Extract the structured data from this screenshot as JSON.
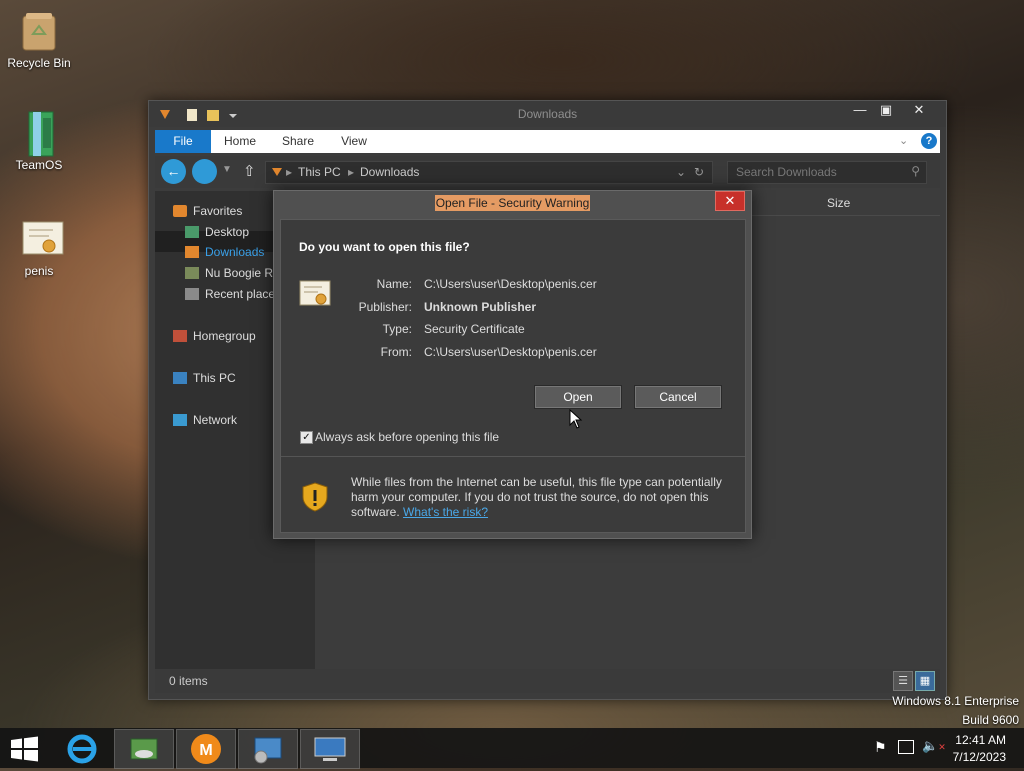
{
  "desktop": {
    "icons": [
      {
        "label": "Recycle Bin",
        "icon": "recycle-bin-icon"
      },
      {
        "label": "TeamOS",
        "icon": "folder-icon"
      },
      {
        "label": "penis",
        "icon": "certificate-file-icon"
      }
    ],
    "watermark": {
      "edition": "Windows 8.1 Enterprise",
      "build": "Build 9600"
    }
  },
  "explorer": {
    "title": "Downloads",
    "tabs": {
      "file": "File",
      "home": "Home",
      "share": "Share",
      "view": "View"
    },
    "address": {
      "root": "This PC",
      "current": "Downloads"
    },
    "search_placeholder": "Search Downloads",
    "nav": {
      "favorites": "Favorites",
      "desktop": "Desktop",
      "downloads": "Downloads",
      "nu_boogie": "Nu Boogie R",
      "recent": "Recent place",
      "homegroup": "Homegroup",
      "this_pc": "This PC",
      "network": "Network"
    },
    "column_size": "Size",
    "status": "0 items"
  },
  "dialog": {
    "title": "Open File - Security Warning",
    "question": "Do you want to open this file?",
    "fields": {
      "name_label": "Name:",
      "name_value": "C:\\Users\\user\\Desktop\\penis.cer",
      "publisher_label": "Publisher:",
      "publisher_value": "Unknown Publisher",
      "type_label": "Type:",
      "type_value": "Security Certificate",
      "from_label": "From:",
      "from_value": "C:\\Users\\user\\Desktop\\penis.cer"
    },
    "open_button": "Open",
    "cancel_button": "Cancel",
    "always_ask": "Always ask before opening this file",
    "always_ask_checked": true,
    "warning": "While files from the Internet can be useful, this file type can potentially harm your computer. If you do not trust the source, do not open this software.",
    "warning_link": "What's the risk?"
  },
  "taskbar": {
    "time": "12:41 AM",
    "date": "7/12/2023",
    "apps": [
      "internet-explorer-icon",
      "media-icon",
      "m-app-icon",
      "control-panel-icon",
      "remote-desktop-icon"
    ]
  }
}
